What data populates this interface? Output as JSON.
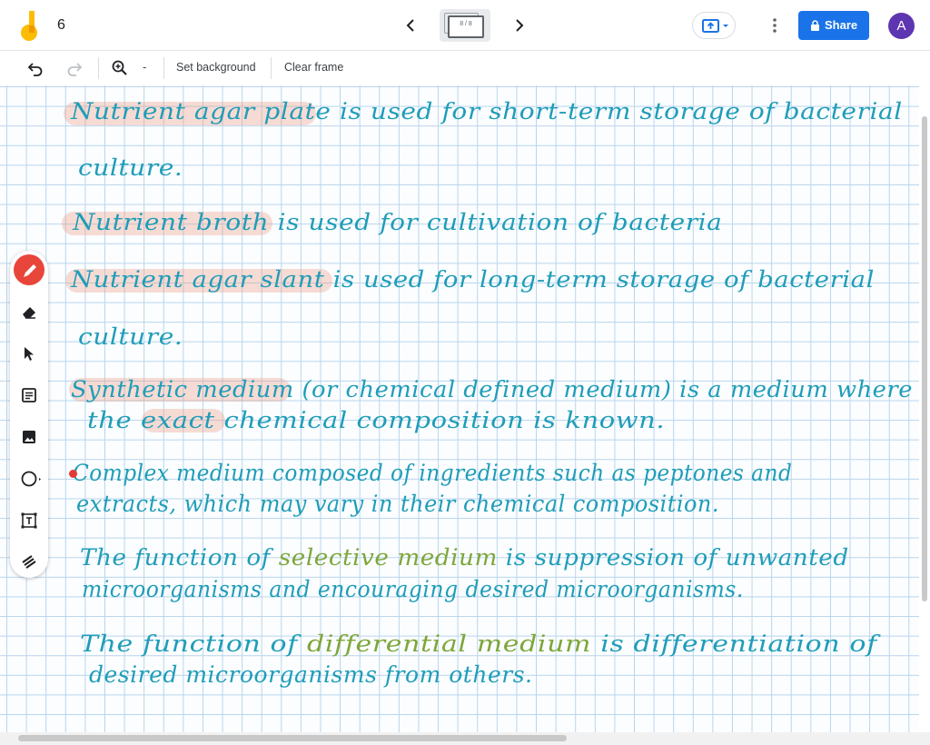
{
  "header": {
    "title": "6",
    "frame_counter": "8 / 8",
    "share_label": "Share",
    "avatar_letter": "A"
  },
  "toolbar": {
    "zoom_level": "-",
    "set_background": "Set background",
    "clear_frame": "Clear frame"
  },
  "tools": [
    "pen",
    "eraser",
    "select",
    "sticky-note",
    "image",
    "circle",
    "text-box",
    "laser"
  ],
  "colors": {
    "ink": "#1f9db8",
    "green_ink": "#7ea63a",
    "highlight": "#ec9678",
    "share_button": "#1a73e8",
    "pen_tool_active": "#e8463a",
    "avatar": "#5e35b1"
  },
  "board": {
    "lines": [
      {
        "before": "",
        "highlight": "Nutrient agar plate",
        "after": " is used for short-term storage of bacterial"
      },
      {
        "before": "culture.",
        "highlight": "",
        "after": ""
      },
      {
        "before": "",
        "highlight": "Nutrient broth",
        "after": " is used for cultivation of bacteria"
      },
      {
        "before": "",
        "highlight": "Nutrient agar slant",
        "after": " is used for long-term storage of bacterial"
      },
      {
        "before": "culture.",
        "highlight": "",
        "after": ""
      },
      {
        "before": "",
        "highlight": "Synthetic medium",
        "after": " (or chemical defined medium) is a medium where"
      },
      {
        "before": "the ",
        "highlight": "exact",
        "after": " chemical composition is known."
      },
      {
        "before": "Complex medium composed of ingredients such as peptones and",
        "highlight": "",
        "after": ""
      },
      {
        "before": "extracts, which may vary in their chemical composition.",
        "highlight": "",
        "after": ""
      },
      {
        "before": "The function of ",
        "green": "selective medium",
        "after": " is suppression of unwanted"
      },
      {
        "before": "microorganisms and encouraging desired microorganisms.",
        "highlight": "",
        "after": ""
      },
      {
        "before": "The function of ",
        "green": "differential medium",
        "after": " is differentiation of"
      },
      {
        "before": "desired microorganisms from others.",
        "highlight": "",
        "after": ""
      }
    ]
  }
}
